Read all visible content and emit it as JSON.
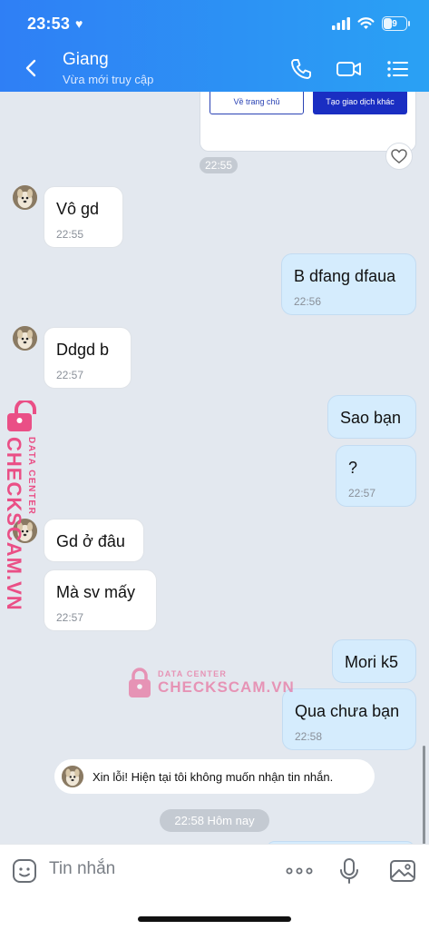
{
  "status_bar": {
    "time": "23:53",
    "battery": "9"
  },
  "header": {
    "contact_name": "Giang",
    "contact_status": "Vừa mới truy cập"
  },
  "card": {
    "home_button": "Về trang chủ",
    "other_button": "Tạo giao dịch khác"
  },
  "messages": [
    {
      "direction": "in",
      "text": "Vô gd",
      "time": "22:55"
    },
    {
      "direction": "out",
      "text": "B dfang dfaua",
      "time": "22:56"
    },
    {
      "direction": "in",
      "text": "Ddgd b",
      "time": "22:57"
    },
    {
      "direction": "out",
      "text": "Sao bạn",
      "time": ""
    },
    {
      "direction": "out",
      "text": "?",
      "time": "22:57"
    },
    {
      "direction": "in",
      "text": "Gd ở đâu",
      "time": ""
    },
    {
      "direction": "in",
      "text": "Mà sv mấy",
      "time": "22:57"
    },
    {
      "direction": "out",
      "text": "Mori k5",
      "time": ""
    },
    {
      "direction": "out",
      "text": "Qua chưa bạn",
      "time": "22:58"
    }
  ],
  "time_pill": "22:55",
  "system_message": "Xin lỗi! Hiện tại tôi không muốn nhận tin nhắn.",
  "date_separator": "22:58 Hôm nay",
  "composer": {
    "placeholder": "Tin nhắn"
  },
  "watermark": {
    "brand": "CHECKSCAM.VN",
    "tagline": "DATA CENTER"
  },
  "colors": {
    "header_start": "#2f7ff5",
    "header_end": "#2aa1f4",
    "outgoing_bubble": "#d5ecfd",
    "incoming_bubble": "#ffffff",
    "chat_background": "#e3e8ef",
    "watermark": "#ea4f86"
  },
  "icons": [
    "back-chevron-icon",
    "phone-icon",
    "video-call-icon",
    "menu-list-icon",
    "heart-icon",
    "sticker-icon",
    "more-icon",
    "microphone-icon",
    "image-icon"
  ]
}
